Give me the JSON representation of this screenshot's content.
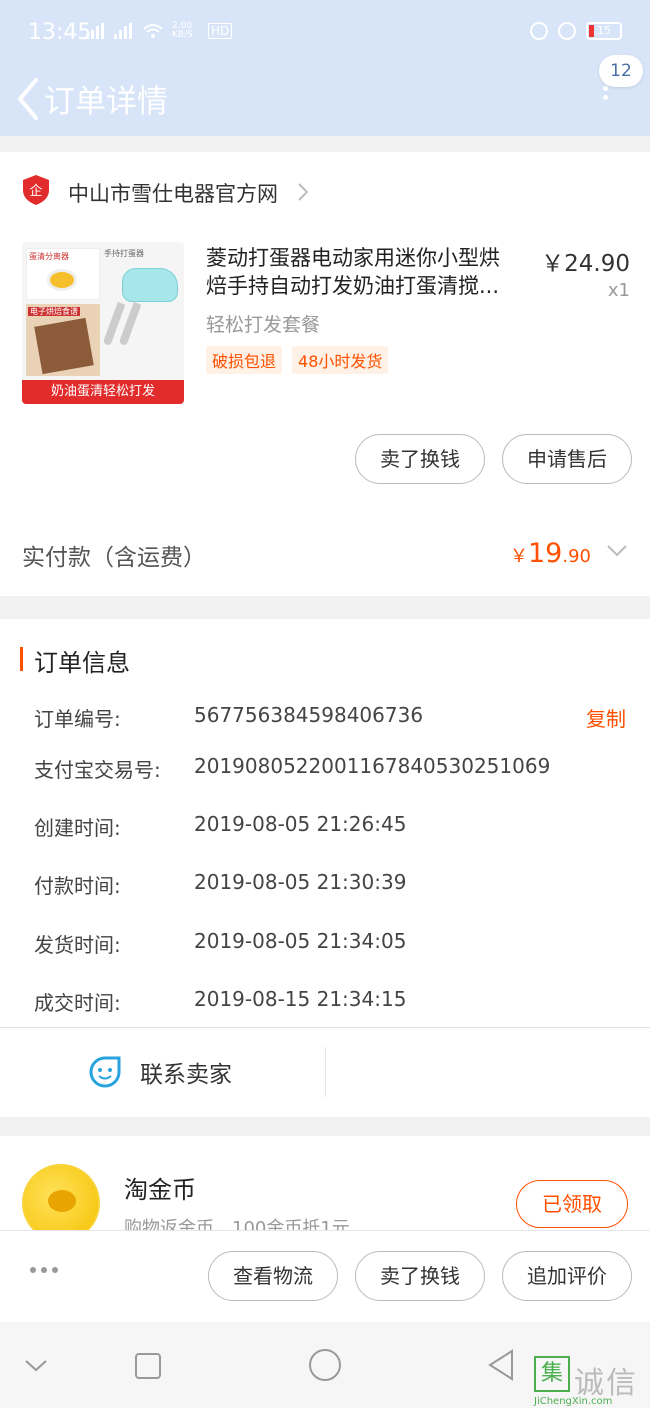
{
  "status_bar": {
    "time": "13:45",
    "net_speed": "2.00 KB/S",
    "battery": "15"
  },
  "nav": {
    "title": "订单详情",
    "badge": "12"
  },
  "shop": {
    "name": "中山市雪仕电器官方网",
    "logo_char": "企"
  },
  "product": {
    "title_line1": "菱动打蛋器电动家用迷你小型烘",
    "title_line2": "焙手持自动打发奶油打蛋清搅...",
    "price": "￥24.90",
    "quantity": "x1",
    "spec": "轻松打发套餐",
    "tags": [
      "破损包退",
      "48小时发货"
    ],
    "image_caption": "奶油蛋清轻松打发",
    "image_labels": [
      "蛋清分离器",
      "手持打蛋器",
      "电子烘焙食谱"
    ]
  },
  "actions": {
    "sell_exchange": "卖了换钱",
    "after_sale": "申请售后",
    "view_logistics": "查看物流",
    "add_review": "追加评价"
  },
  "payment": {
    "label": "实付款（含运费）",
    "currency": "￥",
    "amount_int": "19",
    "amount_dec": ".90"
  },
  "order_info": {
    "title": "订单信息",
    "copy": "复制",
    "rows": [
      {
        "label": "订单编号:",
        "value": "567756384598406736"
      },
      {
        "label": "支付宝交易号:",
        "value": "2019080522001167840530251069"
      },
      {
        "label": "创建时间:",
        "value": "2019-08-05 21:26:45"
      },
      {
        "label": "付款时间:",
        "value": "2019-08-05 21:30:39"
      },
      {
        "label": "发货时间:",
        "value": "2019-08-05 21:34:05"
      },
      {
        "label": "成交时间:",
        "value": "2019-08-15 21:34:15"
      }
    ]
  },
  "contact": {
    "label": "联系卖家"
  },
  "coin": {
    "title": "淘金币",
    "subtitle": "购物返金币，100金币抵1元",
    "button": "已领取"
  },
  "watermark": {
    "chars": "诚信",
    "box_char": "集",
    "url": "JiChengXin.com"
  },
  "colors": {
    "accent": "#ff5000",
    "header_bg": "#d8e5f8",
    "contact_icon": "#29a3e0"
  }
}
